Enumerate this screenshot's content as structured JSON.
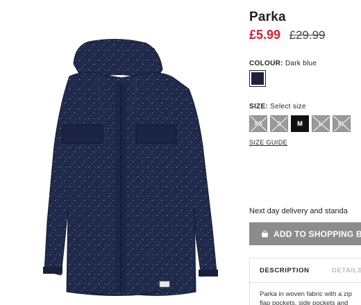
{
  "product": {
    "title": "Parka",
    "price_now": "£5.99",
    "price_old": "£29.99",
    "image_icon": "parka-photo"
  },
  "colour": {
    "label": "COLOUR:",
    "value": "Dark blue",
    "swatch_color": "#1b2240"
  },
  "size": {
    "label": "SIZE:",
    "value": "Select size",
    "options": [
      {
        "label": "XS",
        "available": false
      },
      {
        "label": "S",
        "available": false
      },
      {
        "label": "M",
        "available": true
      },
      {
        "label": "L",
        "available": false
      },
      {
        "label": "XL",
        "available": false
      }
    ],
    "guide": "SIZE GUIDE"
  },
  "delivery": {
    "text": "Next day delivery and standa"
  },
  "cart": {
    "add_label": "ADD TO SHOPPING B",
    "icon": "shopping-bag-icon"
  },
  "tabs": {
    "description": "DESCRIPTION",
    "details": "DETAILS",
    "description_text_1": "Parka in woven fabric with a zip",
    "description_text_2": "flap pockets, side pockets and"
  },
  "colors": {
    "sale_red": "#d4202e",
    "button_grey": "#8c8c8c",
    "jacket_navy": "#1e2847"
  }
}
